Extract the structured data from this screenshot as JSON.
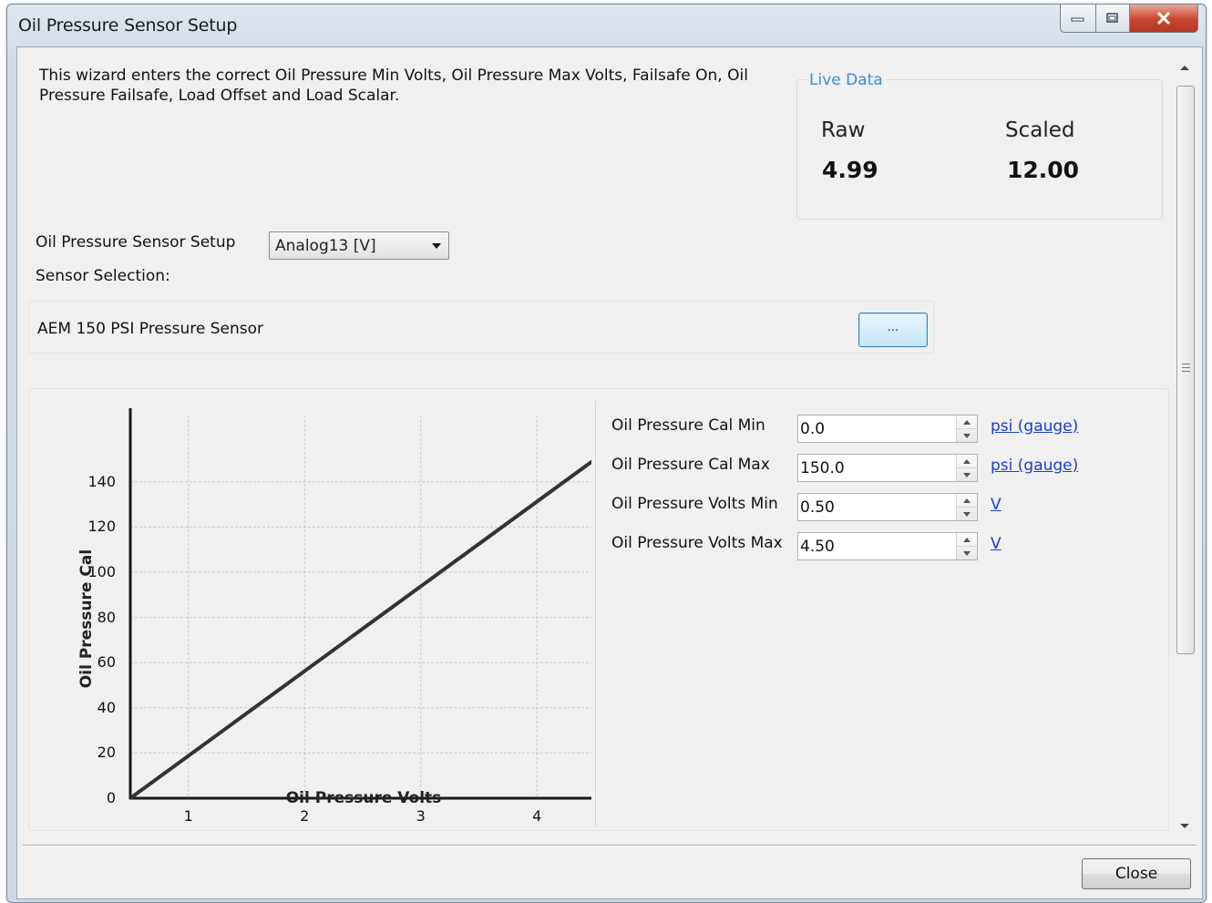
{
  "window": {
    "title": "Oil Pressure Sensor Setup"
  },
  "description": "This wizard enters the correct Oil Pressure Min Volts, Oil Pressure Max Volts, Failsafe On, Oil Pressure Failsafe, Load Offset and Load Scalar.",
  "live_data": {
    "title": "Live Data",
    "raw_label": "Raw",
    "scaled_label": "Scaled",
    "raw_value": "4.99",
    "scaled_value": "12.00"
  },
  "setup": {
    "label": "Oil Pressure Sensor Setup",
    "dropdown_value": "Analog13 [V]",
    "sensor_selection_label": "Sensor Selection:",
    "sensor_name": "AEM 150 PSI Pressure Sensor",
    "browse_label": "..."
  },
  "chart_data": {
    "type": "line",
    "xlabel": "Oil Pressure Volts",
    "ylabel": "Oil Pressure Cal",
    "xlim": [
      0.5,
      4.5
    ],
    "ylim": [
      0,
      150
    ],
    "xticks": [
      "1",
      "2",
      "3",
      "4"
    ],
    "yticks": [
      "0",
      "20",
      "40",
      "60",
      "80",
      "100",
      "120",
      "140"
    ],
    "grid": true,
    "series": [
      {
        "x": [
          0.5,
          4.5
        ],
        "y": [
          0,
          150
        ]
      }
    ]
  },
  "calibration": {
    "rows": [
      {
        "label": "Oil Pressure Cal Min",
        "value": "0.0",
        "unit": "psi (gauge)"
      },
      {
        "label": "Oil Pressure Cal Max",
        "value": "150.0",
        "unit": "psi (gauge)"
      },
      {
        "label": "Oil Pressure Volts Min",
        "value": "0.50",
        "unit": "V"
      },
      {
        "label": "Oil Pressure Volts Max",
        "value": "4.50",
        "unit": "V"
      }
    ]
  },
  "footer": {
    "close_label": "Close"
  },
  "colors": {
    "live_title": "#3b8ed8",
    "link": "#1a3fc7",
    "plot_line": "#333333"
  }
}
